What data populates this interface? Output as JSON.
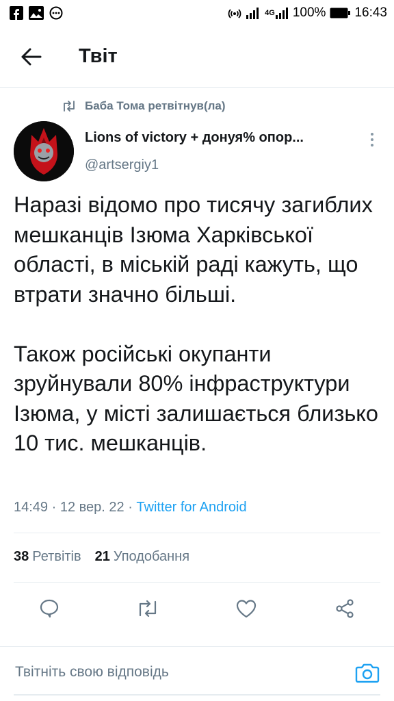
{
  "status_bar": {
    "battery": "100%",
    "time": "16:43",
    "network": "4G",
    "left_icons": [
      "facebook-icon",
      "image-icon",
      "more-circle-icon"
    ],
    "right_icons": [
      "hotspot-icon",
      "signal-icon",
      "signal-4g-icon",
      "battery-icon"
    ]
  },
  "header": {
    "title": "Твіт"
  },
  "tweet": {
    "retweeted_by": "Баба Тома ретвітнув(ла)",
    "author_name": "Lions of victory + дoнуя% опор...",
    "author_handle": "@artsergiy1",
    "paragraphs": [
      "Наразі відомо про тисячу загиблих мешканців Ізюма Харківської області, в міській раді кажуть, що втрати значно більші.",
      "Також російські окупанти зруйнували 80% інфраструктури Ізюма, у місті залишається близько 10 тис. мешканців."
    ],
    "timestamp": "14:49 · 12 вер. 22 · ",
    "source": "Twitter for Android",
    "retweets_count": "38",
    "retweets_label": "Ретвітів",
    "likes_count": "21",
    "likes_label": "Уподобання"
  },
  "reply": {
    "placeholder": "Твітніть свою відповідь"
  },
  "colors": {
    "accent": "#1da1f2",
    "secondary_text": "#657786",
    "divider": "#e6ecf0",
    "icon": "#657786"
  }
}
